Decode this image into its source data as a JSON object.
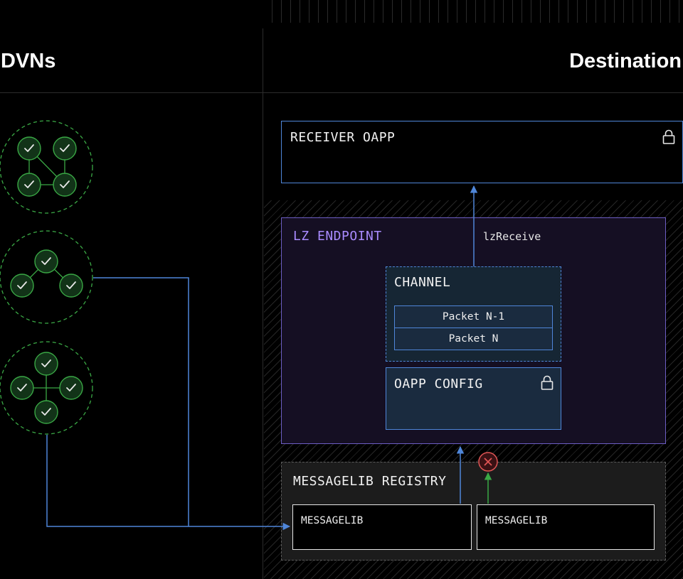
{
  "headings": {
    "left": "DVNs",
    "right": "Destination"
  },
  "receiver_oapp": {
    "label": "RECEIVER OAPP",
    "icon": "lock-icon"
  },
  "lz_endpoint": {
    "label": "LZ ENDPOINT",
    "call_label": "lzReceive"
  },
  "channel": {
    "label": "CHANNEL",
    "packets": [
      "Packet N-1",
      "Packet N"
    ]
  },
  "oapp_config": {
    "label": "OAPP CONFIG",
    "icon": "lock-icon"
  },
  "messagelib_registry": {
    "label": "MESSAGELIB REGISTRY",
    "libs": [
      "MESSAGELIB",
      "MESSAGELIB"
    ]
  },
  "colors": {
    "accent_blue": "#4f86d9",
    "endpoint_purple": "#a98bff",
    "dvn_green": "#3aa845",
    "reject_red": "#e05555"
  }
}
